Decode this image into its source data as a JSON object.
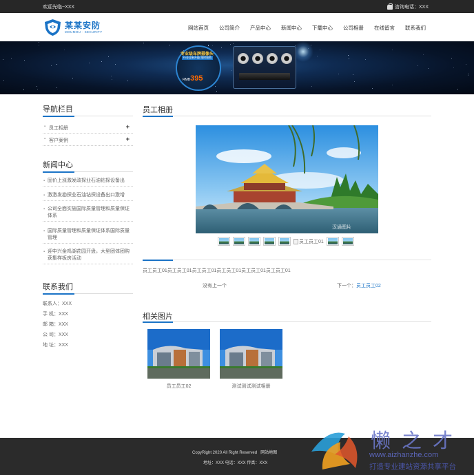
{
  "topbar": {
    "welcome": "欢迎光临~XXX",
    "hotline": "咨询电话：XXX"
  },
  "logo": {
    "name_cn": "某某安防",
    "name_en": "MOUMOU · SECURITY"
  },
  "nav": [
    "网站首页",
    "公司简介",
    "产品中心",
    "新闻中心",
    "下载中心",
    "公司相册",
    "在线留言",
    "联系我们"
  ],
  "banner": {
    "promo_title": "专业级车牌摄像头",
    "promo_sub": "行业全新升级 限时抢购",
    "price_prefix": "RMB",
    "price": "395"
  },
  "sidebar": {
    "nav_title": "导航栏目",
    "categories": [
      {
        "label": "员工相册"
      },
      {
        "label": "客户案例"
      }
    ],
    "news_title": "新闻中心",
    "news": [
      "固价上涨激发政探业石油钻探设备出",
      "激激发勘探业石油钻探设备出口激增",
      "公司全面实施国际质量管理和质量保证体系",
      "国际质量管理和质量保证体系国际质量管理",
      "迎中兴金鸡湖花园开盘，大型团体团购获集样板房活动"
    ],
    "contact_title": "联系我们",
    "contacts": [
      "联系人：XXX",
      "手 机：XXX",
      "邮 箱：XXX",
      "公 司：XXX",
      "地 址：XXX"
    ]
  },
  "main": {
    "title": "员工相册",
    "broken_thumb_alt": "员工员工01",
    "caption": "员工员工01员工员工01员工员工01员工员工01员工员工01员工员工01",
    "prev_text": "没有上一个",
    "next_prefix": "下一个：",
    "next_link": "员工员工02",
    "related_title": "相关图片",
    "related": [
      {
        "caption": "员工员工02"
      },
      {
        "caption": "测试测试测试相册"
      }
    ]
  },
  "footer": {
    "copyright": "CopyRight 2020 All Right Reserved",
    "sitemap": "网站地图",
    "info": "地址：XXX  电话：XXX  传真：XXX"
  },
  "watermark": {
    "cn": "懒之才",
    "url": "www.aizhanzhe.com",
    "slogan": "打造专业建站资源共享平台"
  },
  "colors": {
    "accent": "#1a73c6",
    "topbar": "#272727",
    "footer": "#2b2b2b"
  }
}
